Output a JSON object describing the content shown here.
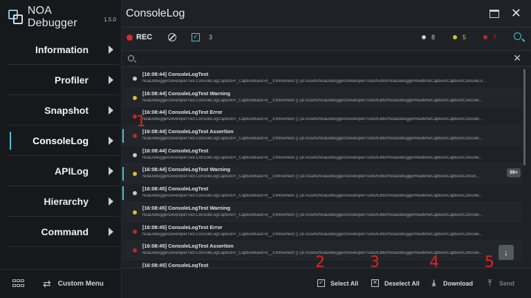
{
  "app": {
    "name": "NOA Debugger",
    "version": "1.5.0"
  },
  "sidebar": {
    "items": [
      {
        "label": "Information"
      },
      {
        "label": "Profiler"
      },
      {
        "label": "Snapshot"
      },
      {
        "label": "ConsoleLog"
      },
      {
        "label": "APILog"
      },
      {
        "label": "Hierarchy"
      },
      {
        "label": "Command"
      }
    ],
    "active_index": 3,
    "footer": {
      "custom_menu_label": "Custom Menu"
    }
  },
  "header": {
    "title": "ConsoleLog"
  },
  "toolbar": {
    "rec_label": "REC",
    "collapse_count": "3",
    "filters": [
      {
        "level": "log",
        "count": "8",
        "color": "#c7ccd1"
      },
      {
        "level": "warning",
        "count": "5",
        "color": "#d6c22a"
      },
      {
        "level": "error",
        "count": "7",
        "color": "#c12828"
      }
    ]
  },
  "search": {
    "value": "",
    "placeholder": ""
  },
  "logs": [
    {
      "level": "log",
      "message": "[16:08:44] ConsoleLogTest",
      "trace": "NoaDebuggerDeveloperTool.ConsoleLogCapture/<_CaptureBase>d__3:MoveNext () (at Assets/NoaDebugger/Developer/Tools/Editor/NoaDebuggerRealtimeCapture/Capture/ConsoleLo...",
      "selected": false,
      "badge": ""
    },
    {
      "level": "warning",
      "message": "[16:08:44] ConsoleLogTest Warning",
      "trace": "NoaDebuggerDeveloperTool.ConsoleLogCapture/<_CaptureBase>d__3:MoveNext () (at Assets/NoaDebugger/Developer/Tools/Editor/NoaDebuggerRealtimeCapture/Capture/Consolel...",
      "selected": false,
      "badge": ""
    },
    {
      "level": "error",
      "message": "[16:08:44] ConsoleLogTest Error",
      "trace": "NoaDebuggerDeveloperTool.ConsoleLogCapture/<_CaptureBase>d__3:MoveNext () (at Assets/NoaDebugger/Developer/Tools/Editor/NoaDebuggerRealtimeCapture/Capture/Consolel...",
      "selected": false,
      "badge": ""
    },
    {
      "level": "error",
      "message": "[16:08:44] ConsoleLogTest Assertion",
      "trace": "NoaDebuggerDeveloperTool.ConsoleLogCapture/<_CaptureBase>d__3:MoveNext () (at Assets/NoaDebugger/Developer/Tools/Editor/NoaDebuggerRealtimeCapture/Capture/Consolel...",
      "selected": true,
      "badge": ""
    },
    {
      "level": "log",
      "message": "[16:08:44] ConsoleLogTest",
      "trace": "NoaDebuggerDeveloperTool.ConsoleLogCapture/<_CaptureBase>d__3:MoveNext () (at Assets/NoaDebugger/Developer/Tools/Editor/NoaDebuggerRealtimeCapture/Capture/Consolel...",
      "selected": false,
      "badge": ""
    },
    {
      "level": "warning",
      "message": "[16:08:44] ConsoleLogTest Warning",
      "trace": "NoaDebuggerDeveloperTool.ConsoleLogCapture/<_CaptureBase>d__3:MoveNext () (at Assets/NoaDebugger/Developer/Tools/Editor/NoaDebuggerRealtimeCapture/Capture/Consol...",
      "selected": true,
      "badge": "99+"
    },
    {
      "level": "log",
      "message": "[16:08:45] ConsoleLogTest",
      "trace": "NoaDebuggerDeveloperTool.ConsoleLogCapture/<_CaptureBase>d__3:MoveNext () (at Assets/NoaDebugger/Developer/Tools/Editor/NoaDebuggerRealtimeCapture/Capture/Consolel...",
      "selected": true,
      "badge": ""
    },
    {
      "level": "warning",
      "message": "[16:08:45] ConsoleLogTest Warning",
      "trace": "NoaDebuggerDeveloperTool.ConsoleLogCapture/<_CaptureBase>d__3:MoveNext () (at Assets/NoaDebugger/Developer/Tools/Editor/NoaDebuggerRealtimeCapture/Capture/Consolel...",
      "selected": false,
      "badge": ""
    },
    {
      "level": "error",
      "message": "[16:08:45] ConsoleLogTest Error",
      "trace": "NoaDebuggerDeveloperTool.ConsoleLogCapture/<_CaptureBase>d__3:MoveNext () (at Assets/NoaDebugger/Developer/Tools/Editor/NoaDebuggerRealtimeCapture/Capture/Consolel...",
      "selected": false,
      "badge": ""
    },
    {
      "level": "error",
      "message": "[16:08:45] ConsoleLogTest Assertion",
      "trace": "NoaDebuggerDeveloperTool.ConsoleLogCapture/<_CaptureBase>d__3:MoveNext () (at Assets/NoaDebugger/Developer/Tools/Editor/NoaDebuggerRealtimeCapture/Capture/Consolel...",
      "selected": false,
      "badge": ""
    },
    {
      "level": "log",
      "message": "[16:08:45] ConsoleLogTest",
      "trace": "",
      "selected": false,
      "badge": ""
    }
  ],
  "level_colors": {
    "log": "#c7ccd1",
    "warning": "#d6c22a",
    "error": "#c12828"
  },
  "annotations": [
    "1",
    "2",
    "3",
    "4",
    "5"
  ],
  "bottom": {
    "select_all_label": "Select All",
    "deselect_all_label": "Deselect All",
    "download_label": "Download",
    "send_label": "Send"
  }
}
